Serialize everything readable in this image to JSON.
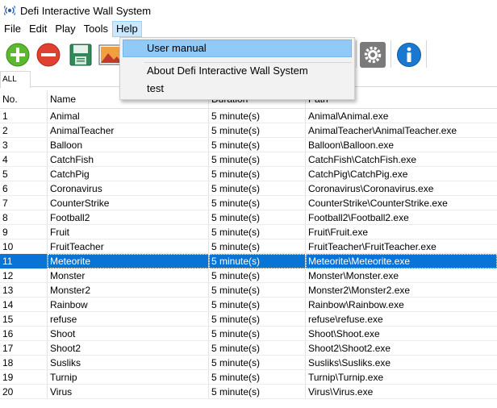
{
  "window": {
    "title": "Defi Interactive Wall System",
    "icon": "app-radio-icon"
  },
  "menubar": {
    "items": [
      {
        "label": "File"
      },
      {
        "label": "Edit"
      },
      {
        "label": "Play"
      },
      {
        "label": "Tools"
      },
      {
        "label": "Help"
      }
    ],
    "open_menu": "Help"
  },
  "toolbar": {
    "buttons": [
      {
        "icon": "add-icon"
      },
      {
        "icon": "remove-icon"
      },
      {
        "icon": "save-icon"
      },
      {
        "icon": "image-icon"
      },
      {
        "icon": "settings-icon"
      },
      {
        "icon": "info-icon"
      }
    ]
  },
  "tabs": [
    {
      "label": "ALL"
    }
  ],
  "help_menu": {
    "items": [
      {
        "label": "User manual"
      },
      {
        "label": "About Defi Interactive Wall System"
      },
      {
        "label": "test"
      }
    ],
    "highlighted": "User manual"
  },
  "table": {
    "columns": [
      {
        "label": "No."
      },
      {
        "label": "Name"
      },
      {
        "label": "Duration"
      },
      {
        "label": "Path"
      }
    ],
    "selected_row": "11",
    "rows": [
      {
        "no": "1",
        "name": "Animal",
        "duration": "5 minute(s)",
        "path": "Animal\\Animal.exe"
      },
      {
        "no": "2",
        "name": "AnimalTeacher",
        "duration": "5 minute(s)",
        "path": "AnimalTeacher\\AnimalTeacher.exe"
      },
      {
        "no": "3",
        "name": "Balloon",
        "duration": "5 minute(s)",
        "path": "Balloon\\Balloon.exe"
      },
      {
        "no": "4",
        "name": "CatchFish",
        "duration": "5 minute(s)",
        "path": "CatchFish\\CatchFish.exe"
      },
      {
        "no": "5",
        "name": "CatchPig",
        "duration": "5 minute(s)",
        "path": "CatchPig\\CatchPig.exe"
      },
      {
        "no": "6",
        "name": "Coronavirus",
        "duration": "5 minute(s)",
        "path": "Coronavirus\\Coronavirus.exe"
      },
      {
        "no": "7",
        "name": "CounterStrike",
        "duration": "5 minute(s)",
        "path": "CounterStrike\\CounterStrike.exe"
      },
      {
        "no": "8",
        "name": "Football2",
        "duration": "5 minute(s)",
        "path": "Football2\\Football2.exe"
      },
      {
        "no": "9",
        "name": "Fruit",
        "duration": "5 minute(s)",
        "path": "Fruit\\Fruit.exe"
      },
      {
        "no": "10",
        "name": "FruitTeacher",
        "duration": "5 minute(s)",
        "path": "FruitTeacher\\FruitTeacher.exe"
      },
      {
        "no": "11",
        "name": "Meteorite",
        "duration": "5 minute(s)",
        "path": "Meteorite\\Meteorite.exe"
      },
      {
        "no": "12",
        "name": "Monster",
        "duration": "5 minute(s)",
        "path": "Monster\\Monster.exe"
      },
      {
        "no": "13",
        "name": "Monster2",
        "duration": "5 minute(s)",
        "path": "Monster2\\Monster2.exe"
      },
      {
        "no": "14",
        "name": "Rainbow",
        "duration": "5 minute(s)",
        "path": "Rainbow\\Rainbow.exe"
      },
      {
        "no": "15",
        "name": "refuse",
        "duration": "5 minute(s)",
        "path": "refuse\\refuse.exe"
      },
      {
        "no": "16",
        "name": "Shoot",
        "duration": "5 minute(s)",
        "path": "Shoot\\Shoot.exe"
      },
      {
        "no": "17",
        "name": "Shoot2",
        "duration": "5 minute(s)",
        "path": "Shoot2\\Shoot2.exe"
      },
      {
        "no": "18",
        "name": "Susliks",
        "duration": "5 minute(s)",
        "path": "Susliks\\Susliks.exe"
      },
      {
        "no": "19",
        "name": "Turnip",
        "duration": "5 minute(s)",
        "path": "Turnip\\Turnip.exe"
      },
      {
        "no": "20",
        "name": "Virus",
        "duration": "5 minute(s)",
        "path": "Virus\\Virus.exe"
      }
    ]
  },
  "colors": {
    "selection": "#0a74d6",
    "menu_open": "#cce8ff",
    "menu_hover": "#91c9f7",
    "add_green": "#5cb82e",
    "remove_red": "#e0402f",
    "info_blue": "#1b78d0"
  }
}
